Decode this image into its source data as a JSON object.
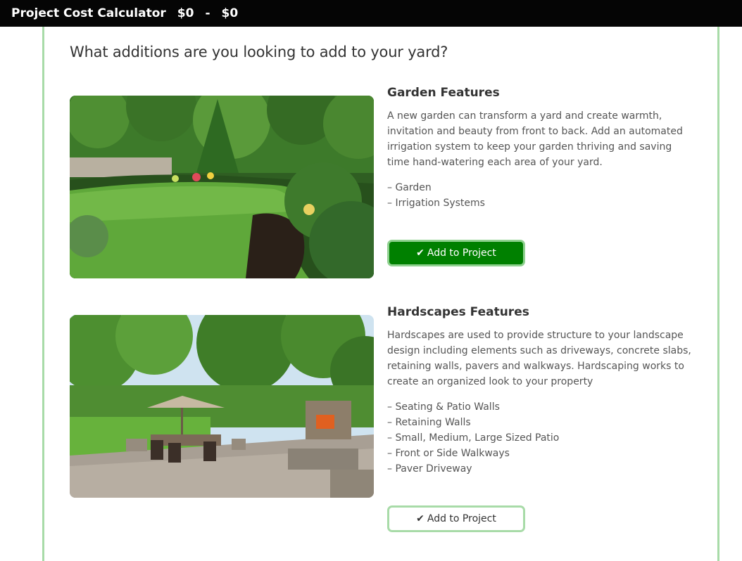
{
  "header": {
    "title": "Project Cost Calculator",
    "min_cost": "$0",
    "separator": "-",
    "max_cost": "$0"
  },
  "question": "What additions are you looking to add to your yard?",
  "features": [
    {
      "title": "Garden Features",
      "description": "A new garden can transform a yard and create warmth, invitation and beauty from front to back. Add an automated irrigation system to keep your garden thriving and saving time hand-watering each area of your yard.",
      "items": [
        "– Garden",
        "– Irrigation Systems"
      ],
      "button_label": "Add to Project",
      "button_state": "added"
    },
    {
      "title": "Hardscapes Features",
      "description": "Hardscapes are used to provide structure to your landscape design including elements such as driveways, concrete slabs, retaining walls, pavers and walkways. Hardscaping works to create an organized look to your property",
      "items": [
        "– Seating & Patio Walls",
        "– Retaining Walls",
        "– Small, Medium, Large Sized Patio",
        "– Front or Side Walkways",
        "– Paver Driveway"
      ],
      "button_label": "Add to Project",
      "button_state": "not-added"
    }
  ],
  "colors": {
    "active_button": "#008000",
    "accent_border": "#a8dba8",
    "header_bg": "#050505"
  },
  "icons": {
    "button_icon": "check-icon"
  }
}
